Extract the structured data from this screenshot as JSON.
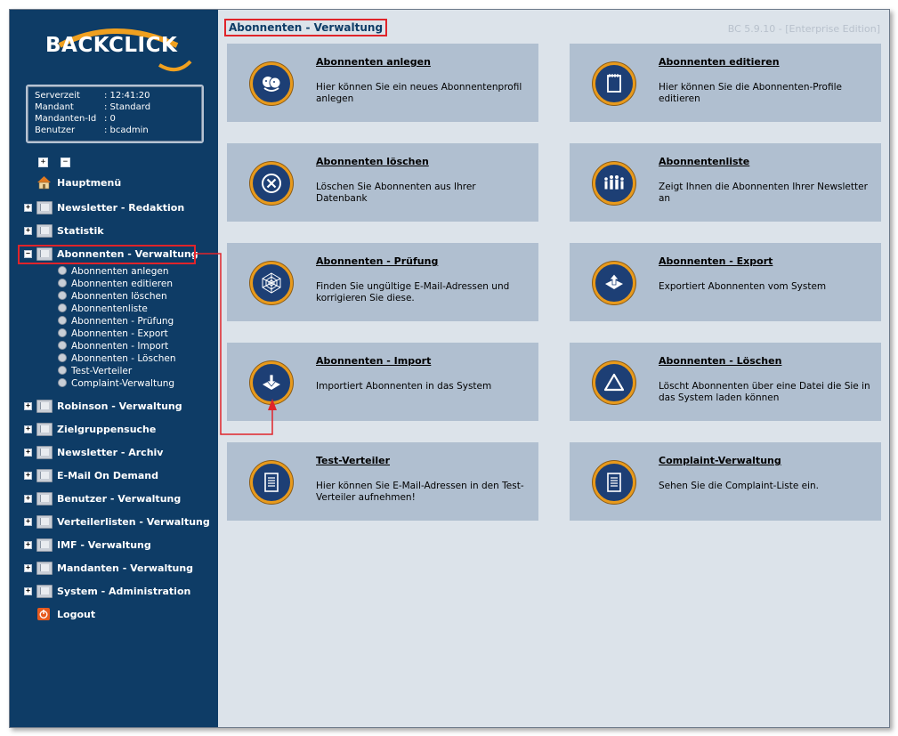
{
  "brand": {
    "logo_text": "BACKCLICK"
  },
  "server_info": [
    {
      "key": "Serverzeit",
      "value": ": 12:41:20"
    },
    {
      "key": "Mandant",
      "value": ": Standard"
    },
    {
      "key": "Mandanten-Id",
      "value": ": 0"
    },
    {
      "key": "Benutzer",
      "value": ": bcadmin"
    }
  ],
  "tree_controls": {
    "expand": "+",
    "collapse": "−"
  },
  "nav": {
    "hauptmenu": "Hauptmenü",
    "items": [
      "Newsletter - Redaktion",
      "Statistik",
      "Abonnenten - Verwaltung",
      "Robinson - Verwaltung",
      "Zielgruppensuche",
      "Newsletter - Archiv",
      "E-Mail On Demand",
      "Benutzer - Verwaltung",
      "Verteilerlisten - Verwaltung",
      "IMF - Verwaltung",
      "Mandanten - Verwaltung",
      "System - Administration"
    ],
    "logout": "Logout",
    "subitems": [
      "Abonnenten anlegen",
      "Abonnenten editieren",
      "Abonnenten löschen",
      "Abonnentenliste",
      "Abonnenten - Prüfung",
      "Abonnenten - Export",
      "Abonnenten - Import",
      "Abonnenten - Löschen",
      "Test-Verteiler",
      "Complaint-Verwaltung"
    ]
  },
  "main": {
    "title": "Abonnenten - Verwaltung",
    "version": "BC 5.9.10 - [Enterprise Edition]",
    "cards": [
      {
        "title": "Abonnenten anlegen",
        "desc": "Hier können Sie ein neues Abonnentenprofil anlegen",
        "icon": "faces-icon"
      },
      {
        "title": "Abonnenten editieren",
        "desc": "Hier können Sie die Abonnenten-Profile editieren",
        "icon": "notepad-icon"
      },
      {
        "title": "Abonnenten löschen",
        "desc": "Löschen Sie Abonnenten aus Ihrer Datenbank",
        "icon": "delete-circle-icon"
      },
      {
        "title": "Abonnentenliste",
        "desc": "Zeigt Ihnen die Abonnenten Ihrer Newsletter an",
        "icon": "people-icon"
      },
      {
        "title": "Abonnenten - Prüfung",
        "desc": "Finden Sie ungültige E-Mail-Adressen und korrigieren Sie diese.",
        "icon": "web-icon"
      },
      {
        "title": "Abonnenten - Export",
        "desc": "Exportiert Abonnenten vom System",
        "icon": "export-icon"
      },
      {
        "title": "Abonnenten - Import",
        "desc": "Importiert Abonnenten in das System",
        "icon": "import-icon"
      },
      {
        "title": "Abonnenten - Löschen",
        "desc": "Löscht Abonnenten über eine Datei die Sie in das System laden können",
        "icon": "triangle-icon"
      },
      {
        "title": "Test-Verteiler",
        "desc": "Hier können Sie E-Mail-Adressen in den Test-Verteiler aufnehmen!",
        "icon": "document-icon"
      },
      {
        "title": "Complaint-Verwaltung",
        "desc": "Sehen Sie die Complaint-Liste ein.",
        "icon": "document-icon"
      }
    ]
  },
  "colors": {
    "sidebar": "#0e3c66",
    "main_bg": "#dce3ea",
    "card_bg": "#b0bfd0",
    "highlight": "#e0242a",
    "icon_ring": "#e89a1c",
    "icon_fill": "#1d3f75"
  }
}
